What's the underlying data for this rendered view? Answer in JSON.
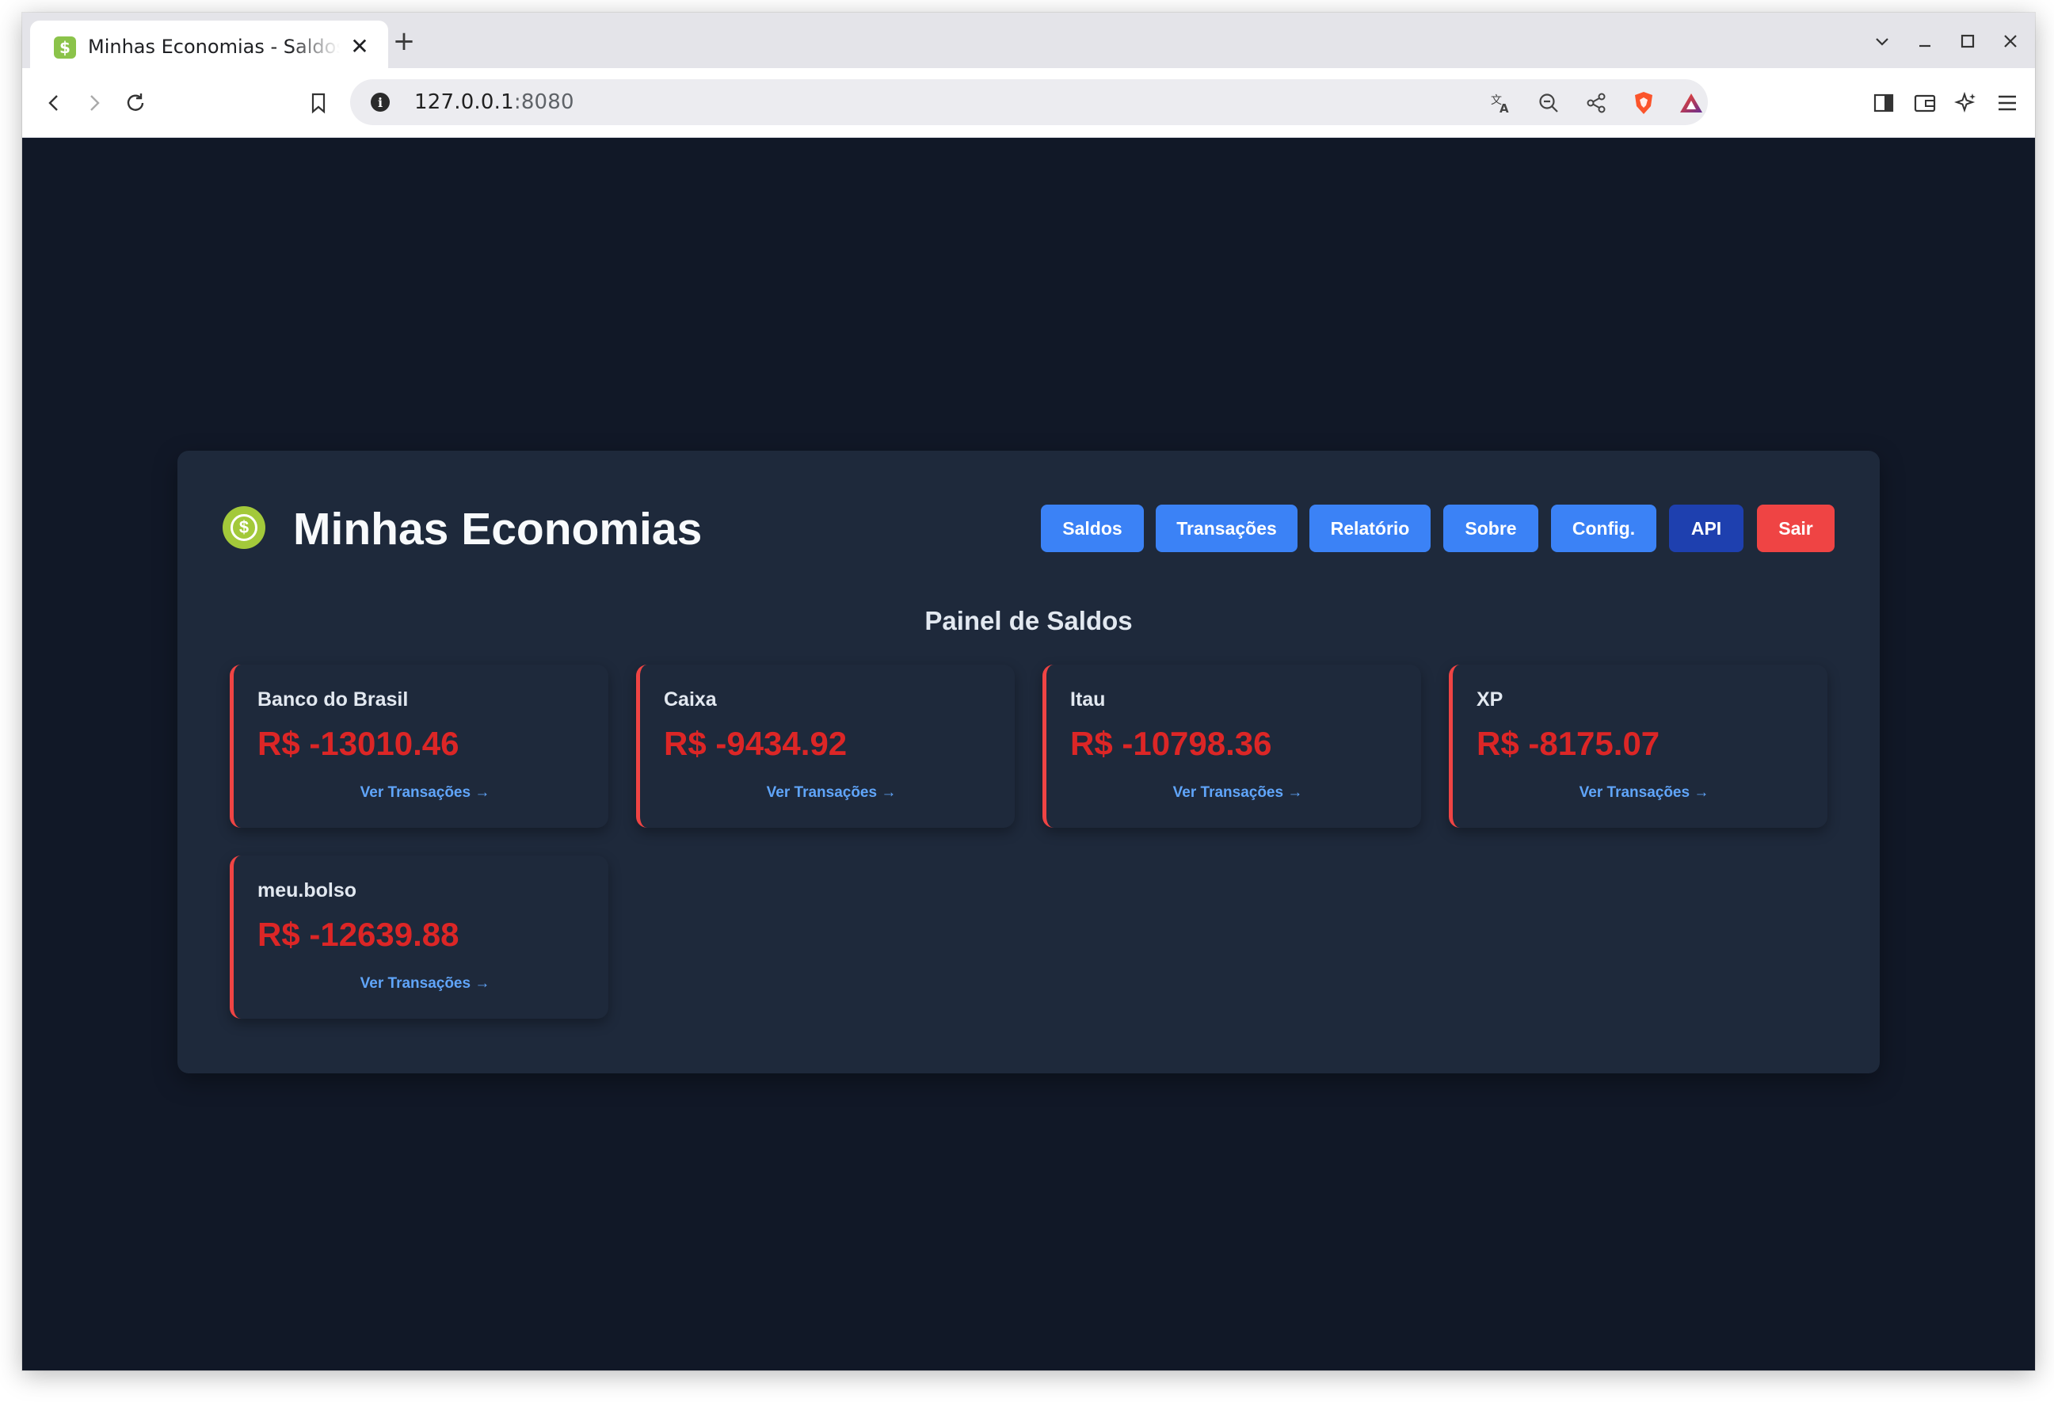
{
  "browser": {
    "tab_title": "Minhas Economias - Saldos",
    "url_host": "127.0.0.1",
    "url_port": ":8080"
  },
  "app": {
    "title": "Minhas Economias",
    "nav": {
      "saldos": "Saldos",
      "transacoes": "Transações",
      "relatorio": "Relatório",
      "sobre": "Sobre",
      "config": "Config.",
      "api": "API",
      "sair": "Sair"
    },
    "section_title": "Painel de Saldos",
    "accounts": [
      {
        "name": "Banco do Brasil",
        "balance": "R$ -13010.46",
        "link": "Ver Transações →"
      },
      {
        "name": "Caixa",
        "balance": "R$ -9434.92",
        "link": "Ver Transações →"
      },
      {
        "name": "Itau",
        "balance": "R$ -10798.36",
        "link": "Ver Transações →"
      },
      {
        "name": "XP",
        "balance": "R$ -8175.07",
        "link": "Ver Transações →"
      },
      {
        "name": "meu.bolso",
        "balance": "R$ -12639.88",
        "link": "Ver Transações →"
      }
    ]
  },
  "colors": {
    "page_bg": "#111827",
    "card_bg": "#1e293b",
    "nav_primary": "#3b82f6",
    "nav_api": "#1e40af",
    "nav_logout": "#ef4444",
    "negative_balance": "#dc2626",
    "link": "#60a5fa",
    "logo": "#a3c93a"
  },
  "icons": {
    "favicon": "dollar-coin-icon",
    "logo": "dollar-coin-icon"
  }
}
